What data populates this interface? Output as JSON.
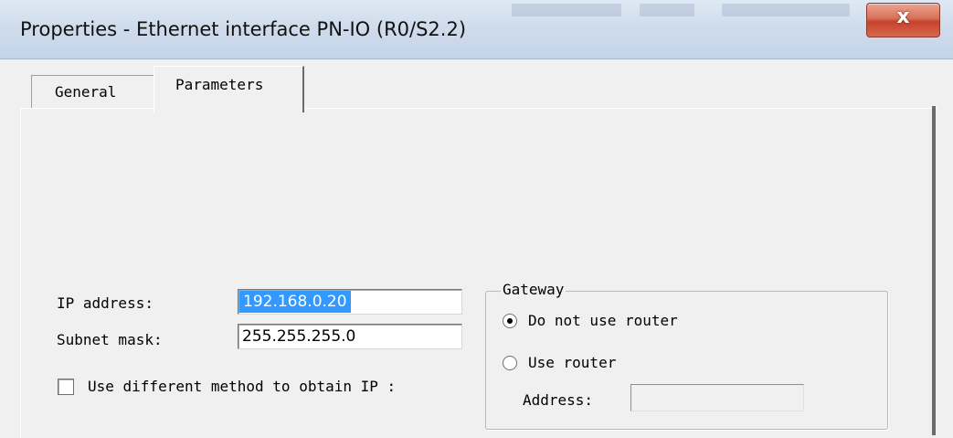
{
  "window": {
    "title": "Properties - Ethernet interface  PN-IO (R0/S2.2)",
    "close_glyph": "x",
    "close_icon": "close-icon"
  },
  "tabs": [
    {
      "label": "General",
      "active": false
    },
    {
      "label": "Parameters",
      "active": true
    }
  ],
  "form": {
    "ip_label": "IP address:",
    "ip_value": "192.168.0.20",
    "subnet_label": "Subnet mask:",
    "subnet_value": "255.255.255.0",
    "different_method_label": "Use different method to obtain IP :",
    "different_method_checked": false
  },
  "gateway": {
    "legend": "Gateway",
    "options": [
      {
        "label": "Do not use router",
        "selected": true
      },
      {
        "label": "Use router",
        "selected": false
      }
    ],
    "address_label": "Address:",
    "address_value": ""
  },
  "colors": {
    "selection": "#3399ff",
    "close_button": "#c7412a",
    "dialog_bg": "#f0f0f0"
  }
}
